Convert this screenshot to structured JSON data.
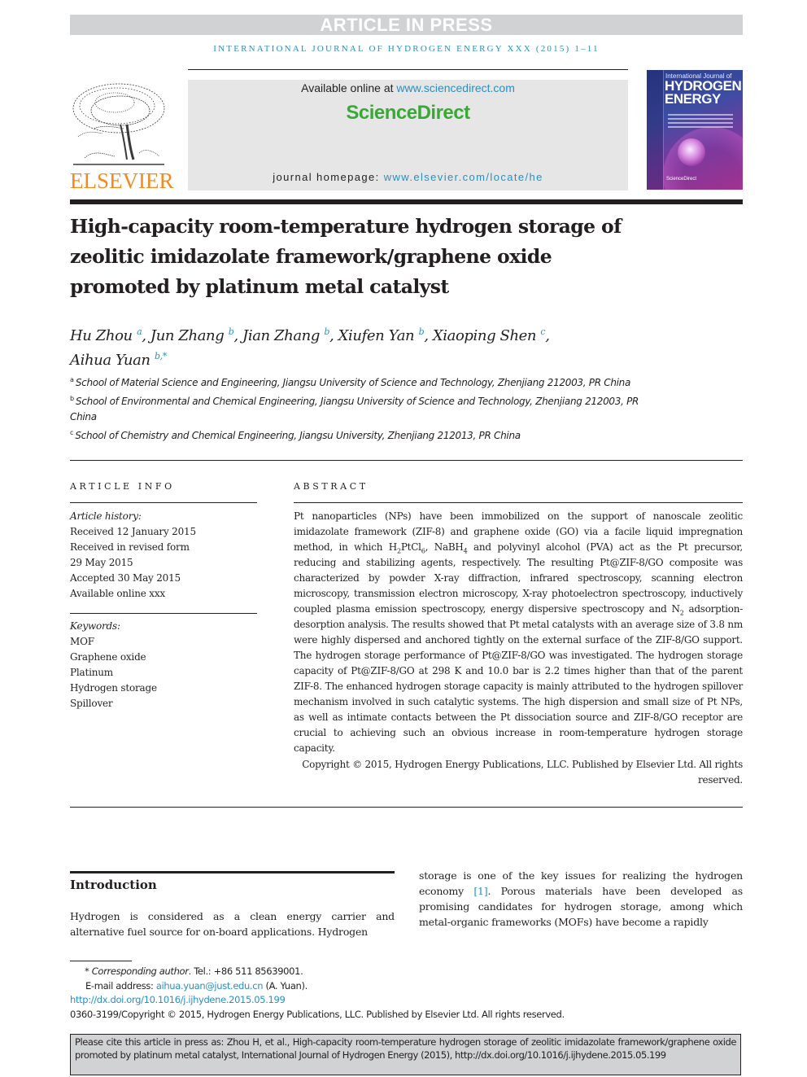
{
  "banner": {
    "article_in_press": "ARTICLE IN PRESS"
  },
  "running_header": "INTERNATIONAL JOURNAL OF HYDROGEN ENERGY XXX (2015) 1–11",
  "masthead": {
    "publisher_logo_text": "ELSEVIER",
    "available_online_prefix": "Available online at ",
    "available_online_url": "www.sciencedirect.com",
    "platform_name": "ScienceDirect",
    "homepage_prefix": "journal homepage: ",
    "homepage_url": "www.elsevier.com/locate/he",
    "cover": {
      "line1": "International Journal of",
      "line2": "HYDROGEN",
      "line3": "ENERGY",
      "footer": "ScienceDirect"
    }
  },
  "article": {
    "title": "High-capacity room-temperature hydrogen storage of zeolitic imidazolate framework/graphene oxide promoted by platinum metal catalyst",
    "authors": [
      {
        "name": "Hu Zhou",
        "aff": "a",
        "sep": ", "
      },
      {
        "name": "Jun Zhang",
        "aff": "b",
        "sep": ", "
      },
      {
        "name": "Jian Zhang",
        "aff": "b",
        "sep": ", "
      },
      {
        "name": "Xiufen Yan",
        "aff": "b",
        "sep": ", "
      },
      {
        "name": "Xiaoping Shen",
        "aff": "c",
        "sep": ", "
      },
      {
        "name": "Aihua Yuan",
        "aff": "b,*",
        "sep": ""
      }
    ],
    "affiliations": [
      {
        "key": "a",
        "text": "School of Material Science and Engineering, Jiangsu University of Science and Technology, Zhenjiang 212003, PR China"
      },
      {
        "key": "b",
        "text": "School of Environmental and Chemical Engineering, Jiangsu University of Science and Technology, Zhenjiang 212003, PR China"
      },
      {
        "key": "c",
        "text": "School of Chemistry and Chemical Engineering, Jiangsu University, Zhenjiang 212013, PR China"
      }
    ]
  },
  "article_info": {
    "heading": "ARTICLE INFO",
    "history_label": "Article history:",
    "history": [
      "Received 12 January 2015",
      "Received in revised form",
      "29 May 2015",
      "Accepted 30 May 2015",
      "Available online xxx"
    ],
    "keywords_label": "Keywords:",
    "keywords": [
      "MOF",
      "Graphene oxide",
      "Platinum",
      "Hydrogen storage",
      "Spillover"
    ]
  },
  "abstract": {
    "heading": "ABSTRACT",
    "p1": "Pt nanoparticles (NPs) have been immobilized on the support of nanoscale zeolitic imidazolate framework (ZIF-8) and graphene oxide (GO) via a facile liquid impregnation method, in which ",
    "chem1_a": "H",
    "chem1_sub1": "2",
    "chem1_b": "PtCl",
    "chem1_sub2": "6",
    "p2": ", ",
    "chem2_a": "NaBH",
    "chem2_sub": "4",
    "p3": " and polyvinyl alcohol (PVA) act as the Pt precursor, reducing and stabilizing agents, respectively. The resulting Pt@ZIF-8/GO composite was characterized by powder X-ray diffraction, infrared spectroscopy, scanning electron microscopy, transmission electron microscopy, X-ray photoelectron spectroscopy, inductively coupled plasma emission spectroscopy, energy dispersive spectroscopy and ",
    "chem3_a": "N",
    "chem3_sub": "2",
    "p4": " adsorption-desorption analysis. The results showed that Pt metal catalysts with an average size of 3.8 nm were highly dispersed and anchored tightly on the external surface of the ZIF-8/GO support. The hydrogen storage performance of Pt@ZIF-8/GO was investigated. The hydrogen storage capacity of Pt@ZIF-8/GO at 298 K and 10.0 bar is 2.2 times higher than that of the parent ZIF-8. The enhanced hydrogen storage capacity is mainly attributed to the hydrogen spillover mechanism involved in such catalytic systems. The high dispersion and small size of Pt NPs, as well as intimate contacts between the Pt dissociation source and ZIF-8/GO receptor are crucial to achieving such an obvious increase in room-temperature hydrogen storage capacity.",
    "copyright": "Copyright © 2015, Hydrogen Energy Publications, LLC. Published by Elsevier Ltd. All rights reserved."
  },
  "introduction": {
    "heading": "Introduction",
    "left_text": "Hydrogen is considered as a clean energy carrier and alternative fuel source for on-board applications. Hydrogen",
    "right_text_a": "storage is one of the key issues for realizing the hydrogen economy ",
    "right_ref": "[1]",
    "right_text_b": ". Porous materials have been developed as promising candidates for hydrogen storage, among which metal-organic frameworks (MOFs) have become a rapidly"
  },
  "footnotes": {
    "star": "* ",
    "corresponding_label": "Corresponding author",
    "tel": ". Tel.: +86 511 85639001.",
    "email_label": "E-mail address: ",
    "email": "aihua.yuan@just.edu.cn",
    "email_suffix": " (A. Yuan).",
    "doi": "http://dx.doi.org/10.1016/j.ijhydene.2015.05.199",
    "issn_copyright": "0360-3199/Copyright © 2015, Hydrogen Energy Publications, LLC. Published by Elsevier Ltd. All rights reserved."
  },
  "citation_box": "Please cite this article in press as: Zhou H, et al., High-capacity room-temperature hydrogen storage of zeolitic imidazolate framework/graphene oxide promoted by platinum metal catalyst, International Journal of Hydrogen Energy (2015), http://dx.doi.org/10.1016/j.ijhydene.2015.05.199"
}
